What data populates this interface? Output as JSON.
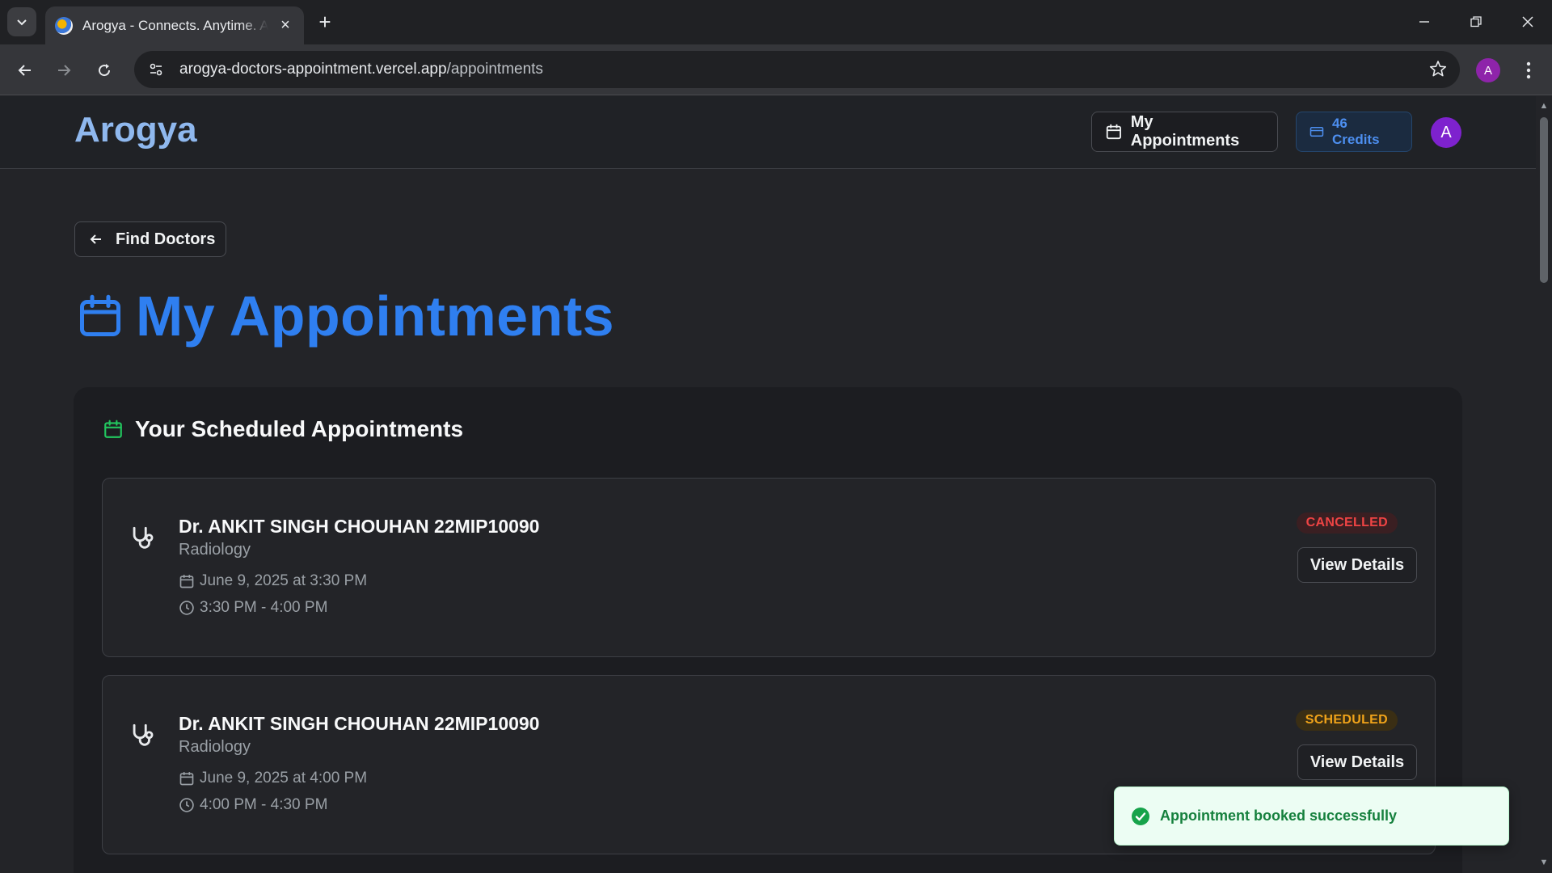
{
  "browser": {
    "tab_title": "Arogya - Connects. Anytime. Anywhere",
    "url_domain": "arogya-doctors-appointment.vercel.app",
    "url_path": "/appointments",
    "profile_initial": "A"
  },
  "header": {
    "brand": "Arogya",
    "appointments_label": "My Appointments",
    "credits_label": "46 Credits",
    "avatar_initial": "A"
  },
  "back_button": {
    "label": "Find Doctors"
  },
  "page": {
    "title": "My Appointments"
  },
  "panel": {
    "title": "Your Scheduled Appointments"
  },
  "appointments": [
    {
      "doctor": "Dr. ANKIT SINGH CHOUHAN 22MIP10090",
      "specialty": "Radiology",
      "date": "June 9, 2025 at 3:30 PM",
      "time": "3:30 PM - 4:00 PM",
      "status": "CANCELLED",
      "action": "View Details"
    },
    {
      "doctor": "Dr. ANKIT SINGH CHOUHAN 22MIP10090",
      "specialty": "Radiology",
      "date": "June 9, 2025 at 4:00 PM",
      "time": "4:00 PM - 4:30 PM",
      "status": "SCHEDULED",
      "action": "View Details"
    }
  ],
  "toast": {
    "message": "Appointment booked successfully"
  },
  "colors": {
    "accent": "#2f7ff0",
    "brand": "#8fb8ee",
    "cancelled": "#ef4444",
    "scheduled": "#f0a31a",
    "success": "#15803d"
  },
  "icons": {
    "tab_list": "chevron-down-icon",
    "back": "arrow-left-icon",
    "forward": "arrow-right-icon",
    "reload": "reload-icon",
    "site_info": "tune-icon",
    "bookmark": "star-icon",
    "menu": "kebab-icon",
    "calendar": "calendar-icon",
    "credits": "card-icon",
    "doctor": "stethoscope-icon",
    "clock": "clock-icon",
    "success": "check-circle-icon"
  }
}
